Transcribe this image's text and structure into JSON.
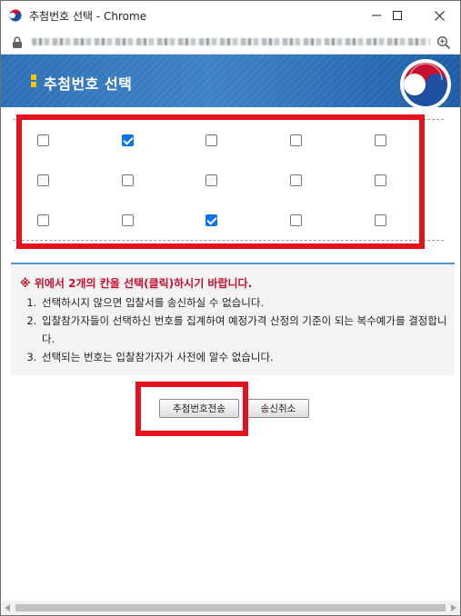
{
  "window": {
    "title": "추첨번호 선택 - Chrome",
    "controls": {
      "minimize": "minimize-icon",
      "maximize": "maximize-icon",
      "close": "close-icon"
    }
  },
  "address_bar": {
    "lock_icon": "lock-icon",
    "zoom_icon": "zoom-icon"
  },
  "header": {
    "title": "추첨번호 선택",
    "emblem": "government-emblem"
  },
  "grid": {
    "rows": [
      [
        false,
        true,
        false,
        false,
        false
      ],
      [
        false,
        false,
        false,
        false,
        false
      ],
      [
        false,
        false,
        true,
        false,
        false
      ]
    ],
    "checked_color": "#0a74e8"
  },
  "notice": {
    "warning": "※ 위에서 2개의 칸을 선택(클릭)하시기 바랍니다.",
    "items": [
      "선택하시지 않으면 입찰서를 송신하실 수 없습니다.",
      "입찰참가자들이 선택하신 번호를 집계하여 예정가격 산정의 기준이 되는 복수예가를 결정합니다.",
      "선택되는 번호는 입찰참가자가 사전에 알수 없습니다."
    ]
  },
  "buttons": {
    "send": "추첨번호전송",
    "cancel": "송신취소"
  },
  "colors": {
    "highlight_red": "#e3121d",
    "header_blue": "#2c6fb6",
    "warning_red": "#c8102e"
  }
}
